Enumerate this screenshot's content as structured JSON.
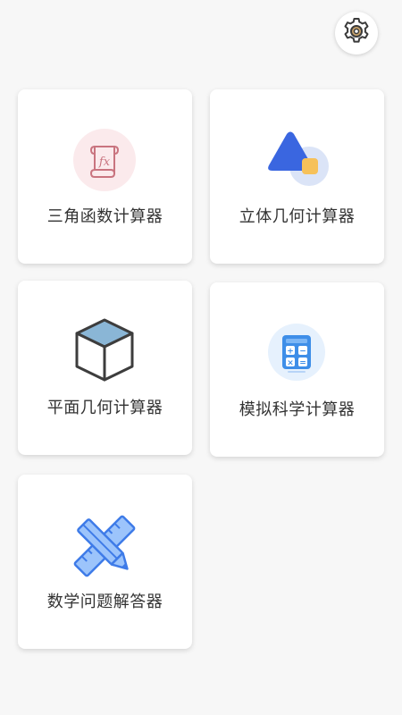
{
  "header": {
    "settings_icon": "gear-icon"
  },
  "cards": [
    {
      "label": "三角函数计算器",
      "icon": "formula-scroll-icon"
    },
    {
      "label": "立体几何计算器",
      "icon": "triangle-square-shapes-icon"
    },
    {
      "label": "平面几何计算器",
      "icon": "cube-icon"
    },
    {
      "label": "模拟科学计算器",
      "icon": "calculator-icon"
    },
    {
      "label": "数学问题解答器",
      "icon": "pencil-ruler-icon"
    }
  ],
  "colors": {
    "background": "#f7f7f7",
    "card": "#ffffff",
    "text": "#333333",
    "accent_blue": "#3a66e0",
    "accent_yellow": "#f6c15a",
    "formula_red": "#c9747f",
    "cube_top": "#8ab6d6",
    "calculator_blue": "#3e8ee8"
  }
}
